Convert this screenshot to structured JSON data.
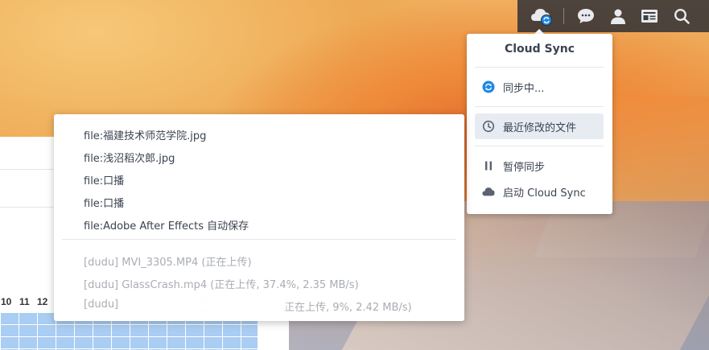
{
  "taskbar": {
    "icons": [
      "cloud-sync-icon",
      "chat-icon",
      "user-icon",
      "widgets-icon",
      "search-icon"
    ],
    "colors": {
      "cloud_badge": "#1e88e5",
      "icon": "#e8eaed"
    }
  },
  "cloud_sync_menu": {
    "title": "Cloud Sync",
    "items": [
      {
        "label": "同步中...",
        "icon": "sync-icon"
      },
      {
        "label": "最近修改的文件",
        "icon": "clock-icon"
      },
      {
        "label": "暂停同步",
        "icon": "pause-icon"
      },
      {
        "label": "启动 Cloud Sync",
        "icon": "cloud-icon"
      }
    ]
  },
  "recent_files": {
    "files": [
      "file:福建技术师范学院.jpg",
      "file:浅沼稻次郎.jpg",
      "file:口播",
      "file:口播",
      "file:Adobe After Effects 自动保存"
    ],
    "uploads": [
      "[dudu] MVI_3305.MP4 (正在上传)",
      "[dudu] GlassCrash.mp4 (正在上传, 37.4%, 2.35 MB/s)",
      "[dudu]",
      "正在上传, 9%, 2.42 MB/s)"
    ]
  },
  "background_app": {
    "day_numbers": [
      "10",
      "11",
      "12"
    ]
  }
}
